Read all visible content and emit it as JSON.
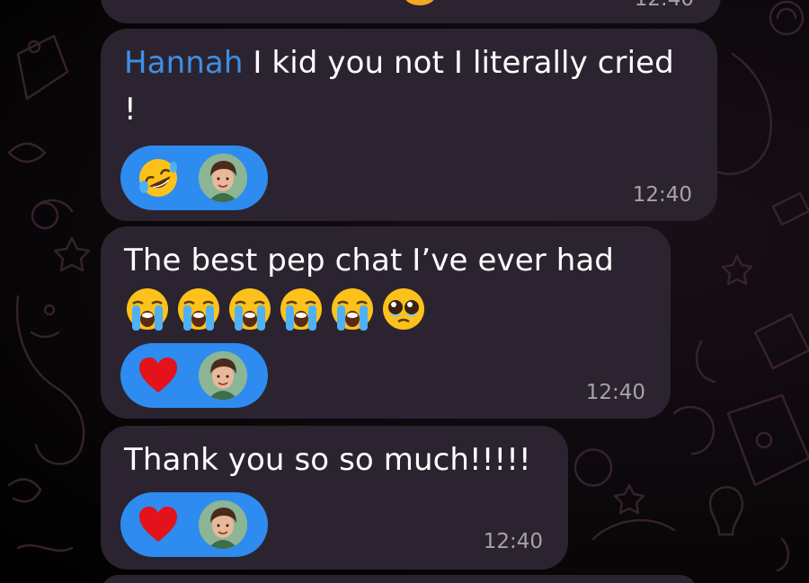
{
  "messages": [
    {
      "sender": "Hannah",
      "text": " I kid you not I literally cried\n!",
      "reaction_emoji": "rolling-on-floor-laughing-icon",
      "time": "12:40"
    },
    {
      "text": "The best pep chat I’ve ever had",
      "emojis": [
        "loudly-crying-face-icon",
        "loudly-crying-face-icon",
        "loudly-crying-face-icon",
        "loudly-crying-face-icon",
        "loudly-crying-face-icon",
        "pleading-face-icon"
      ],
      "reaction_emoji": "red-heart-icon",
      "time": "12:40"
    },
    {
      "text": "Thank you so so much!!!!!",
      "reaction_emoji": "red-heart-icon",
      "time": "12:40"
    }
  ],
  "top_partial_time": "12:40",
  "colors": {
    "bubble": "#2b2430",
    "sender": "#3d8fe6",
    "reaction_pill": "#2e8bf0",
    "time": "#a8a1ab"
  }
}
